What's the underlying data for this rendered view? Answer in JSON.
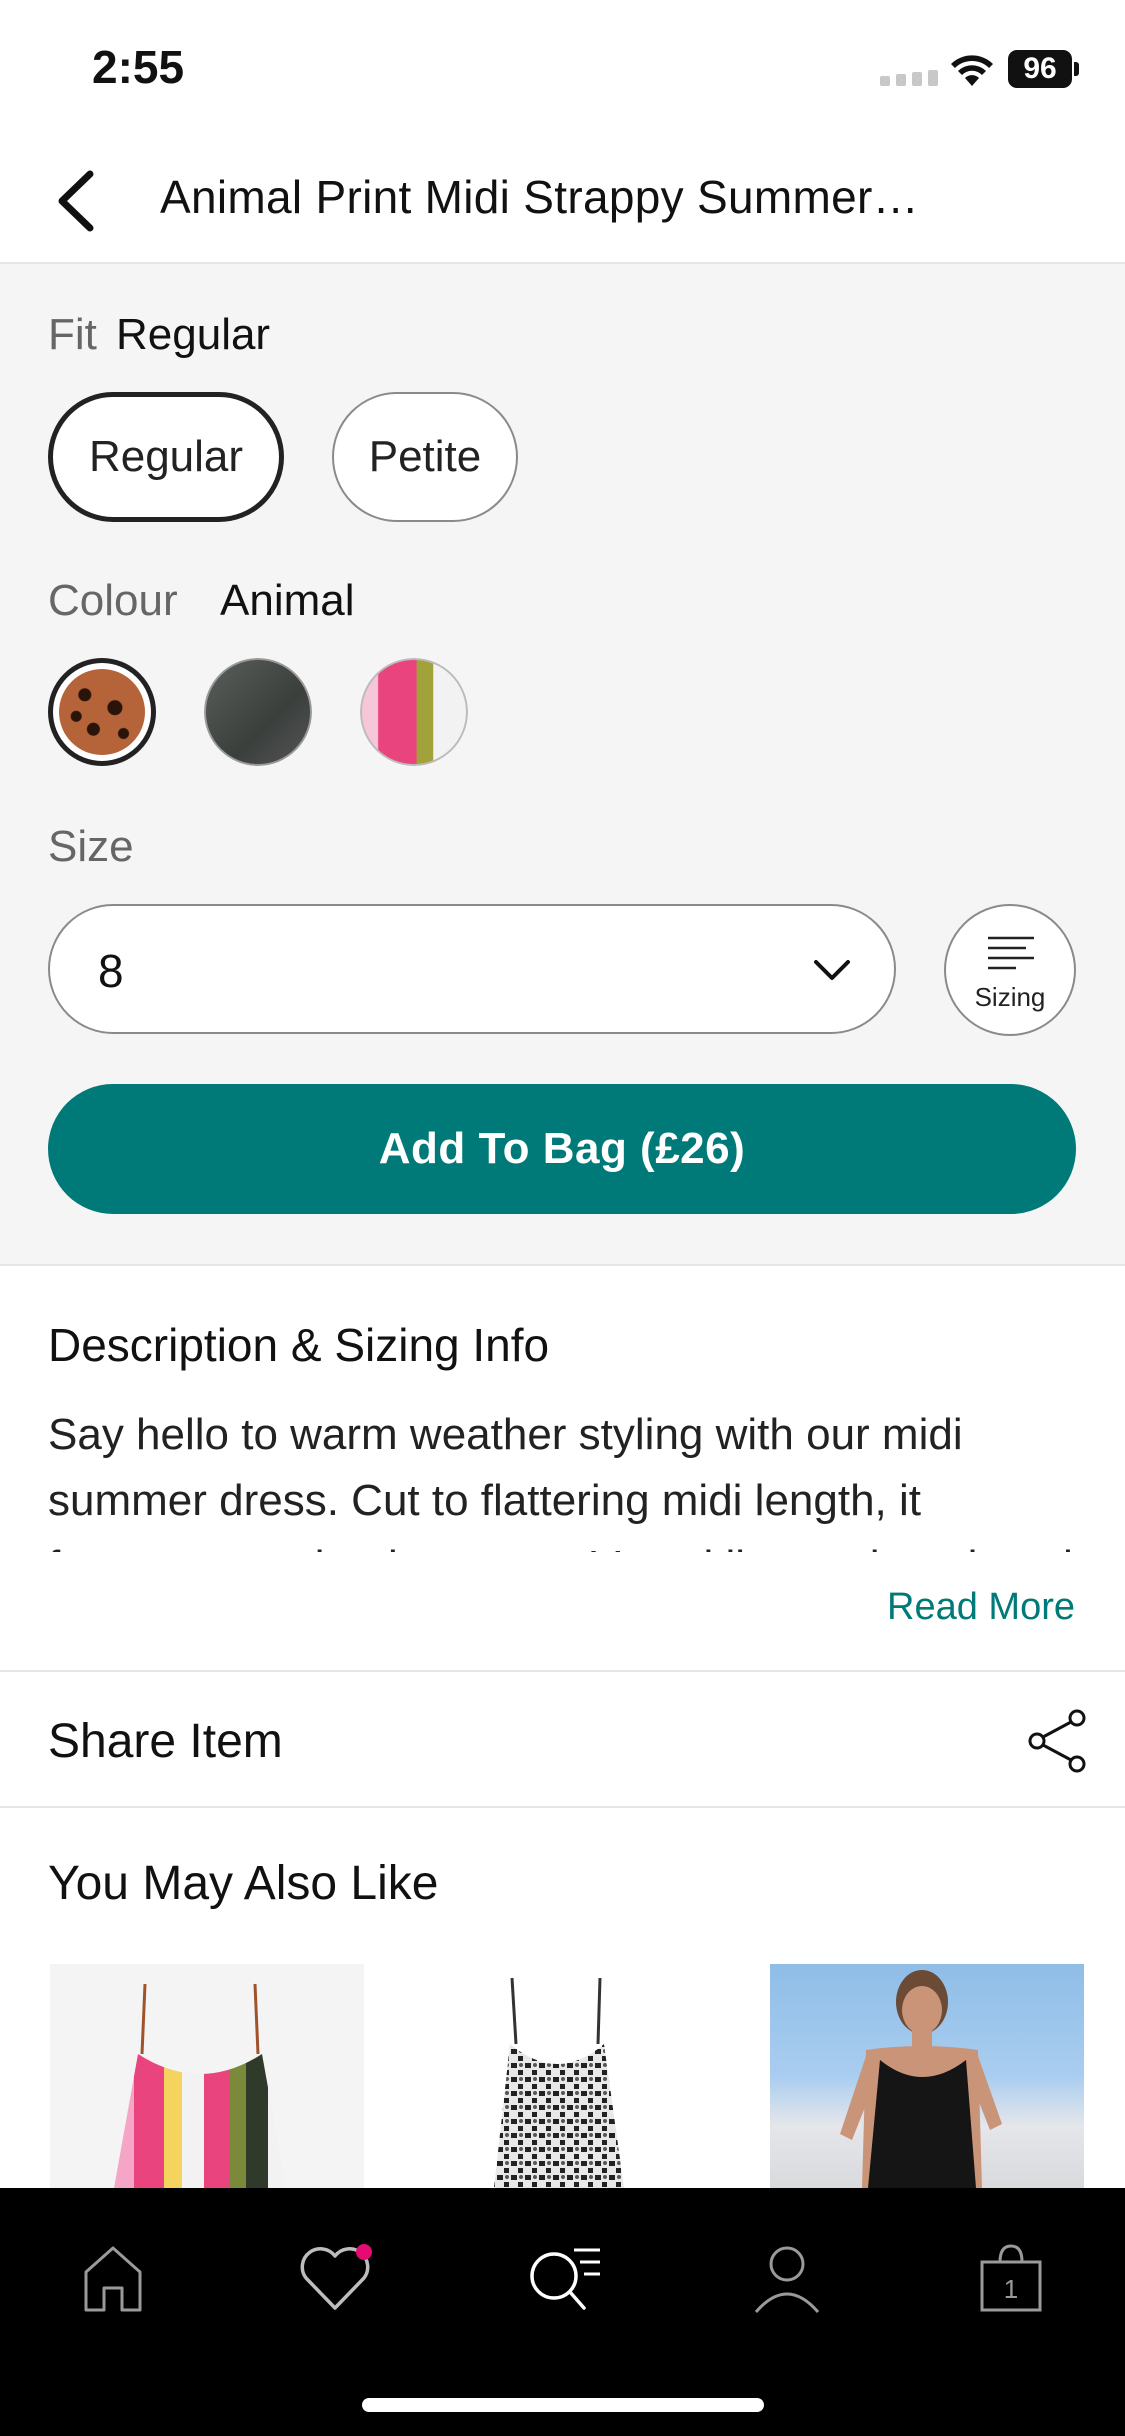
{
  "status_bar": {
    "time": "2:55",
    "battery": "96"
  },
  "header": {
    "title": "Animal Print Midi Strappy Summer…"
  },
  "fit": {
    "label": "Fit",
    "selected": "Regular",
    "options": [
      "Regular",
      "Petite"
    ]
  },
  "colour": {
    "label": "Colour",
    "selected": "Animal",
    "swatches": [
      "animal-print",
      "dark-print",
      "pink-stripe"
    ]
  },
  "size": {
    "label": "Size",
    "selected": "8",
    "sizing_label": "Sizing"
  },
  "add_to_bag": {
    "label": "Add To Bag (£26)"
  },
  "description": {
    "title": "Description & Sizing Info",
    "body": "Say hello to warm weather styling with our midi summer dress. Cut to flattering midi length, it features spaghetti straps, a V-neckline and a relaxed fit.",
    "read_more": "Read More"
  },
  "share": {
    "label": "Share Item"
  },
  "recommendations": {
    "title": "You May Also Like",
    "items": [
      "striped-strappy-dress",
      "monochrome-print-dress",
      "black-slip-dress"
    ]
  },
  "tab_bar": {
    "items": [
      "home-icon",
      "heart-icon",
      "search-icon",
      "account-icon",
      "bag-icon"
    ],
    "bag_count": "1",
    "accent_color": "#e60a73"
  },
  "colors": {
    "brand": "#007a78",
    "background": "#f5f5f5"
  }
}
